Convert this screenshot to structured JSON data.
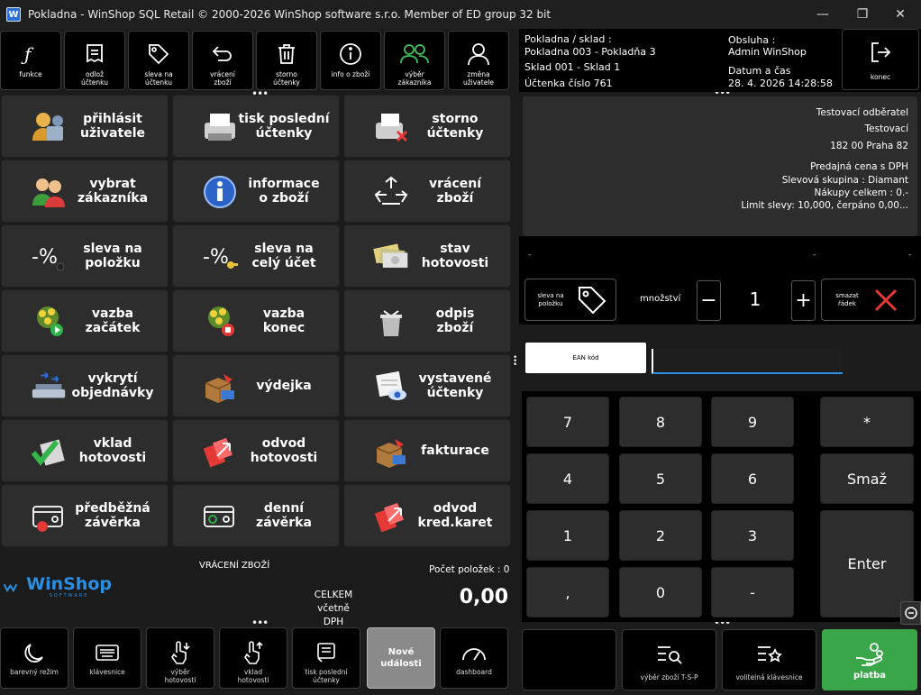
{
  "window": {
    "title": "Pokladna - WinShop SQL Retail © 2000-2026 WinShop software s.r.o.  Member of ED group 32 bit",
    "minimize": "—",
    "maximize": "❐",
    "close": "✕"
  },
  "toolbar": [
    {
      "label": "funkce",
      "icon": "function-icon"
    },
    {
      "label": "odlož\núčtenku",
      "icon": "receipt-icon"
    },
    {
      "label": "sleva na\núčtenku",
      "icon": "tag-icon"
    },
    {
      "label": "vrácení\nzboží",
      "icon": "return-icon"
    },
    {
      "label": "storno\núčtenky",
      "icon": "trash-icon"
    },
    {
      "label": "info o zboží",
      "icon": "info-icon"
    },
    {
      "label": "výběr\nzákazníka",
      "icon": "users-icon"
    },
    {
      "label": "změna\nuživatele",
      "icon": "user-icon"
    }
  ],
  "grid": [
    {
      "label": "přihlásit\nuživatele",
      "icon": "login-users-icon"
    },
    {
      "label": "tisk poslední\núčtenky",
      "icon": "printer-icon"
    },
    {
      "label": "storno\núčtenky",
      "icon": "printer-cancel-icon"
    },
    {
      "label": "vybrat\nzákazníka",
      "icon": "customers-icon"
    },
    {
      "label": "informace\no zboží",
      "icon": "info-circle-icon"
    },
    {
      "label": "vrácení\nzboží",
      "icon": "recycle-icon"
    },
    {
      "label": "sleva na\npoložku",
      "icon": "percent-icon"
    },
    {
      "label": "sleva na\ncelý účet",
      "icon": "percent-key-icon"
    },
    {
      "label": "stav\nhotovosti",
      "icon": "banknotes-icon"
    },
    {
      "label": "vazba\nzačátek",
      "icon": "bouquet-play-icon"
    },
    {
      "label": "vazba\nkonec",
      "icon": "bouquet-stop-icon"
    },
    {
      "label": "odpis\nzboží",
      "icon": "bin-icon"
    },
    {
      "label": "vykrytí\nobjednávky",
      "icon": "scale-icon"
    },
    {
      "label": "výdejka",
      "icon": "box-out-icon"
    },
    {
      "label": "vystavené\núčtenky",
      "icon": "receipt-eye-icon"
    },
    {
      "label": "vklad\nhotovosti",
      "icon": "cash-in-icon"
    },
    {
      "label": "odvod\nhotovosti",
      "icon": "cash-out-icon"
    },
    {
      "label": "fakturace",
      "icon": "box-invoice-icon"
    },
    {
      "label": "předběžná\nzávěrka",
      "icon": "card-record-icon"
    },
    {
      "label": "denní\nzávěrka",
      "icon": "card-green-icon"
    },
    {
      "label": "odvod\nkred.karet",
      "icon": "cards-out-icon"
    }
  ],
  "status": {
    "mode": "VRÁCENÍ ZBOŽÍ",
    "item_count": "Počet položek : 0",
    "total_label": "CELKEM\nvčetně DPH",
    "total": "0,00",
    "logo": "WinShop",
    "logo_sub": "SOFTWARE"
  },
  "bottombar": [
    {
      "label": "barevný režim",
      "icon": "moon-icon"
    },
    {
      "label": "klávesnice",
      "icon": "keyboard-icon"
    },
    {
      "label": "výběr\nhotovosti",
      "icon": "cash-withdraw-icon"
    },
    {
      "label": "vklad\nhotovosti",
      "icon": "cash-deposit-icon"
    },
    {
      "label": "tisk poslední\núčtenky",
      "icon": "receipt-print-icon"
    },
    {
      "label": "Nové\nudálosti",
      "icon": ""
    },
    {
      "label": "dashboard",
      "icon": "gauge-icon"
    }
  ],
  "info": {
    "register_label": "Pokladna / sklad :",
    "register": "Pokladna 003 - Pokladňa 3",
    "warehouse": "Sklad 001 - Sklad 1",
    "receipt": "Účtenka číslo 761",
    "operator_label": "Obsluha :",
    "operator": "Admin WinShop",
    "datetime_label": "Datum a čas",
    "datetime": "28. 4. 2026 14:28:58",
    "exit": "konec"
  },
  "customer": {
    "lines": [
      "Testovací odběratel",
      "Testovací",
      "182 00 Praha 82",
      "Predajná cena s DPH",
      "Slevová skupina : Diamant",
      "Nákupy celkem : 0.-",
      "Limit slevy: 10,000, čerpáno 0,00..."
    ]
  },
  "item": {
    "dash_left": "-",
    "dash_mid": "-",
    "dash_right": "-",
    "discount_label": "sleva na\npoložku",
    "quantity_label": "množství",
    "minus": "−",
    "quantity": "1",
    "plus": "+",
    "delete_row": "smazat\nřádek"
  },
  "ean": {
    "label": "EAN kód",
    "value": ""
  },
  "numpad": {
    "keys": [
      "7",
      "8",
      "9",
      "4",
      "5",
      "6",
      "1",
      "2",
      "3",
      ",",
      "0",
      "-"
    ],
    "star": "*",
    "clear": "Smaž",
    "enter": "Enter"
  },
  "rightbar": {
    "search": "výběr zboží T-S-P",
    "custom_kb": "volitelná klávesnice",
    "pay": "platba"
  },
  "colors": {
    "pay": "#3aa64a",
    "accent": "#e53935",
    "green_icon": "#42c25a"
  }
}
